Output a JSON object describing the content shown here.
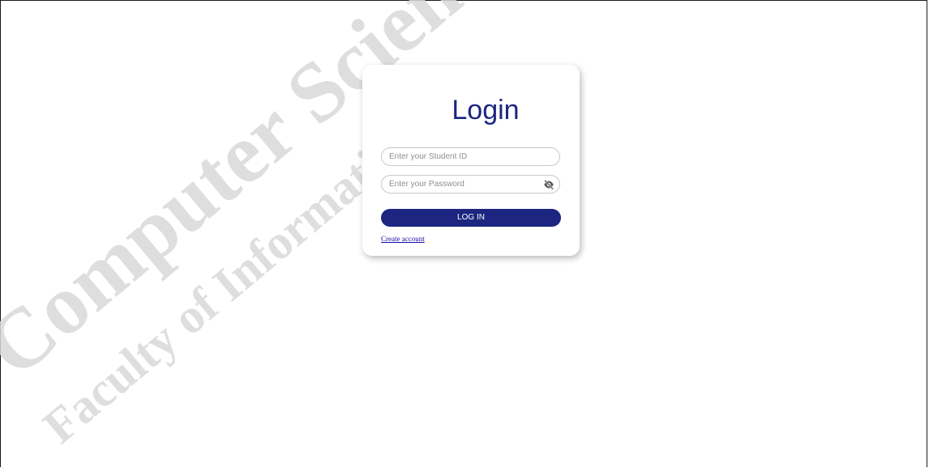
{
  "login": {
    "title": "Login",
    "student_id_placeholder": "Enter your Student ID",
    "password_placeholder": "Enter your Password",
    "submit_label": "LOG IN",
    "create_account_link": "Create account",
    "password_toggle_icon": "eye-slash-icon"
  },
  "watermark": {
    "line1": "Computer Science, M",
    "line2": "Faculty of Informatics,"
  },
  "colors": {
    "accent": "#1c2680",
    "link": "#1a0dab",
    "watermark": "#d9d9d9"
  }
}
